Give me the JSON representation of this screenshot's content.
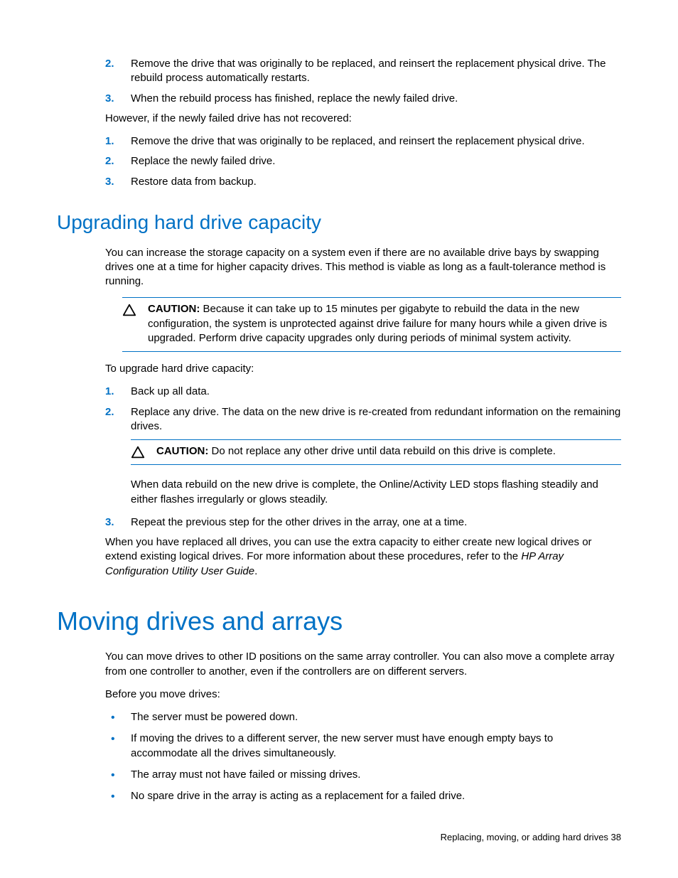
{
  "top_list": [
    {
      "num": "2.",
      "text": "Remove the drive that was originally to be replaced, and reinsert the replacement physical drive. The rebuild process automatically restarts."
    },
    {
      "num": "3.",
      "text": "When the rebuild process has finished, replace the newly failed drive."
    }
  ],
  "however_text": "However, if the newly failed drive has not recovered:",
  "however_list": [
    {
      "num": "1.",
      "text": "Remove the drive that was originally to be replaced, and reinsert the replacement physical drive."
    },
    {
      "num": "2.",
      "text": "Replace the newly failed drive."
    },
    {
      "num": "3.",
      "text": "Restore data from backup."
    }
  ],
  "upgrade_heading": "Upgrading hard drive capacity",
  "upgrade_intro": "You can increase the storage capacity on a system even if there are no available drive bays by swapping drives one at a time for higher capacity drives. This method is viable as long as a fault-tolerance method is running.",
  "caution1_label": "CAUTION:",
  "caution1_text": "  Because it can take up to 15 minutes per gigabyte to rebuild the data in the new configuration, the system is unprotected against drive failure for many hours while a given drive is upgraded. Perform drive capacity upgrades only during periods of minimal system activity.",
  "upgrade_lead": "To upgrade hard drive capacity:",
  "upgrade_steps": [
    {
      "num": "1.",
      "text": "Back up all data."
    },
    {
      "num": "2.",
      "text": "Replace any drive. The data on the new drive is re-created from redundant information on the remaining drives."
    },
    {
      "num": "3.",
      "text": "Repeat the previous step for the other drives in the array, one at a time."
    }
  ],
  "caution2_label": "CAUTION:",
  "caution2_text": "  Do not replace any other drive until data rebuild on this drive is complete.",
  "rebuild_complete_text": "When data rebuild on the new drive is complete, the Online/Activity LED stops flashing steadily and either flashes irregularly or glows steadily.",
  "after_all_text_1": "When you have replaced all drives, you can use the extra capacity to either create new logical drives or extend existing logical drives. For more information about these procedures, refer to the ",
  "after_all_italic": "HP Array Configuration Utility User Guide",
  "after_all_text_2": ".",
  "moving_heading": "Moving drives and arrays",
  "moving_intro": "You can move drives to other ID positions on the same array controller. You can also move a complete array from one controller to another, even if the controllers are on different servers.",
  "moving_lead": "Before you move drives:",
  "moving_bullets": [
    "The server must be powered down.",
    "If moving the drives to a different server, the new server must have enough empty bays to accommodate all the drives simultaneously.",
    "The array must not have failed or missing drives.",
    "No spare drive in the array is acting as a replacement for a failed drive."
  ],
  "footer_text": "Replacing, moving, or adding hard drives   38"
}
